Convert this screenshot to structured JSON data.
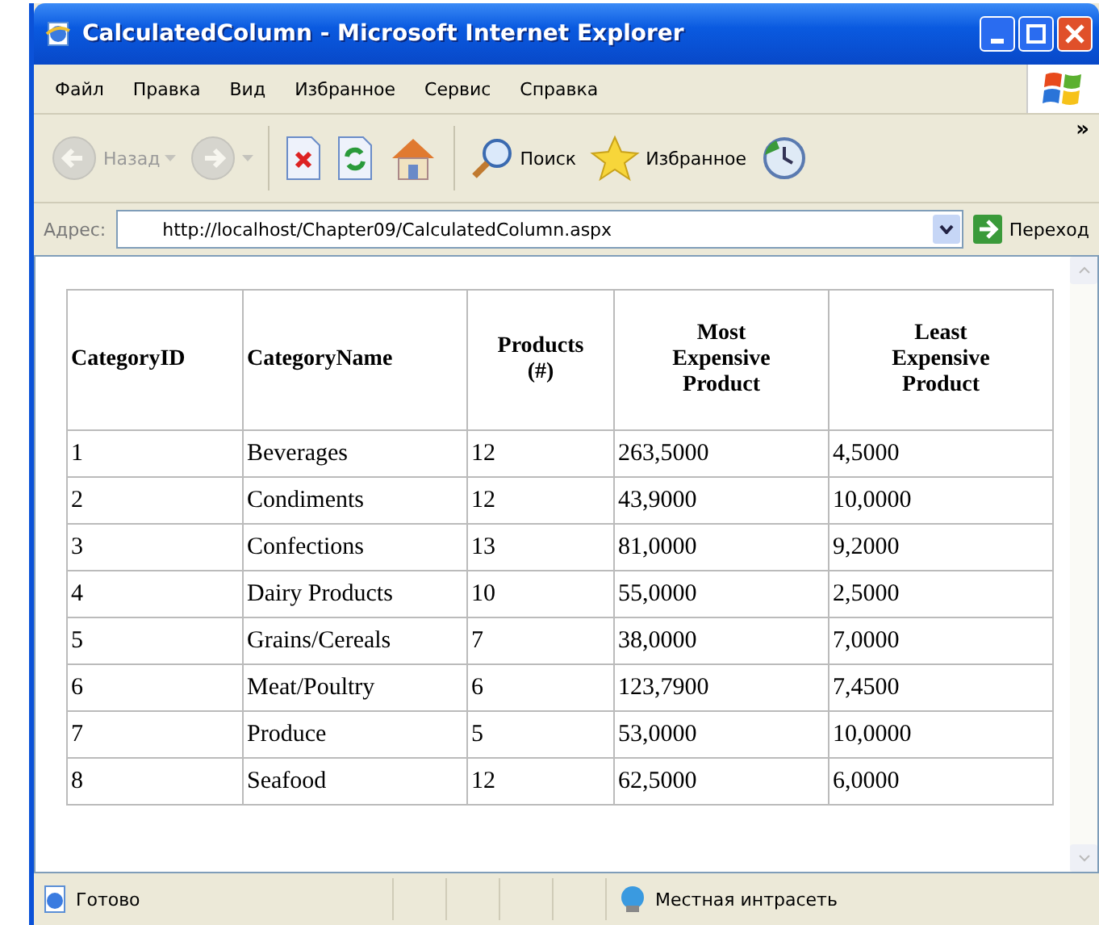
{
  "window": {
    "title": "CalculatedColumn - Microsoft Internet Explorer"
  },
  "menu": [
    "Файл",
    "Правка",
    "Вид",
    "Избранное",
    "Сервис",
    "Справка"
  ],
  "toolbar": [
    {
      "kind": "back",
      "label": "Назад",
      "disabled": true
    },
    {
      "kind": "forward",
      "disabled": true
    },
    {
      "kind": "stop",
      "disabled": false
    },
    {
      "kind": "refresh",
      "disabled": false
    },
    {
      "kind": "home",
      "disabled": false
    },
    {
      "kind": "search",
      "label": "Поиск",
      "disabled": false
    },
    {
      "kind": "favorites",
      "label": "Избранное",
      "disabled": false
    },
    {
      "kind": "history",
      "disabled": false
    }
  ],
  "toolbar_more": "»",
  "address": {
    "label": "Адрес:",
    "value": "http://localhost/Chapter09/CalculatedColumn.aspx",
    "go": "Переход"
  },
  "table": {
    "columns": [
      "CategoryID",
      "CategoryName",
      "Products (#)",
      "Most Expensive Product",
      "Least Expensive Product"
    ],
    "rows": [
      [
        "1",
        "Beverages",
        "12",
        "263,5000",
        "4,5000"
      ],
      [
        "2",
        "Condiments",
        "12",
        "43,9000",
        "10,0000"
      ],
      [
        "3",
        "Confections",
        "13",
        "81,0000",
        "9,2000"
      ],
      [
        "4",
        "Dairy Products",
        "10",
        "55,0000",
        "2,5000"
      ],
      [
        "5",
        "Grains/Cereals",
        "7",
        "38,0000",
        "7,0000"
      ],
      [
        "6",
        "Meat/Poultry",
        "6",
        "123,7900",
        "7,4500"
      ],
      [
        "7",
        "Produce",
        "5",
        "53,0000",
        "10,0000"
      ],
      [
        "8",
        "Seafood",
        "12",
        "62,5000",
        "6,0000"
      ]
    ]
  },
  "status_bar": {
    "text": "Готово",
    "zone": "Местная интрасеть"
  }
}
